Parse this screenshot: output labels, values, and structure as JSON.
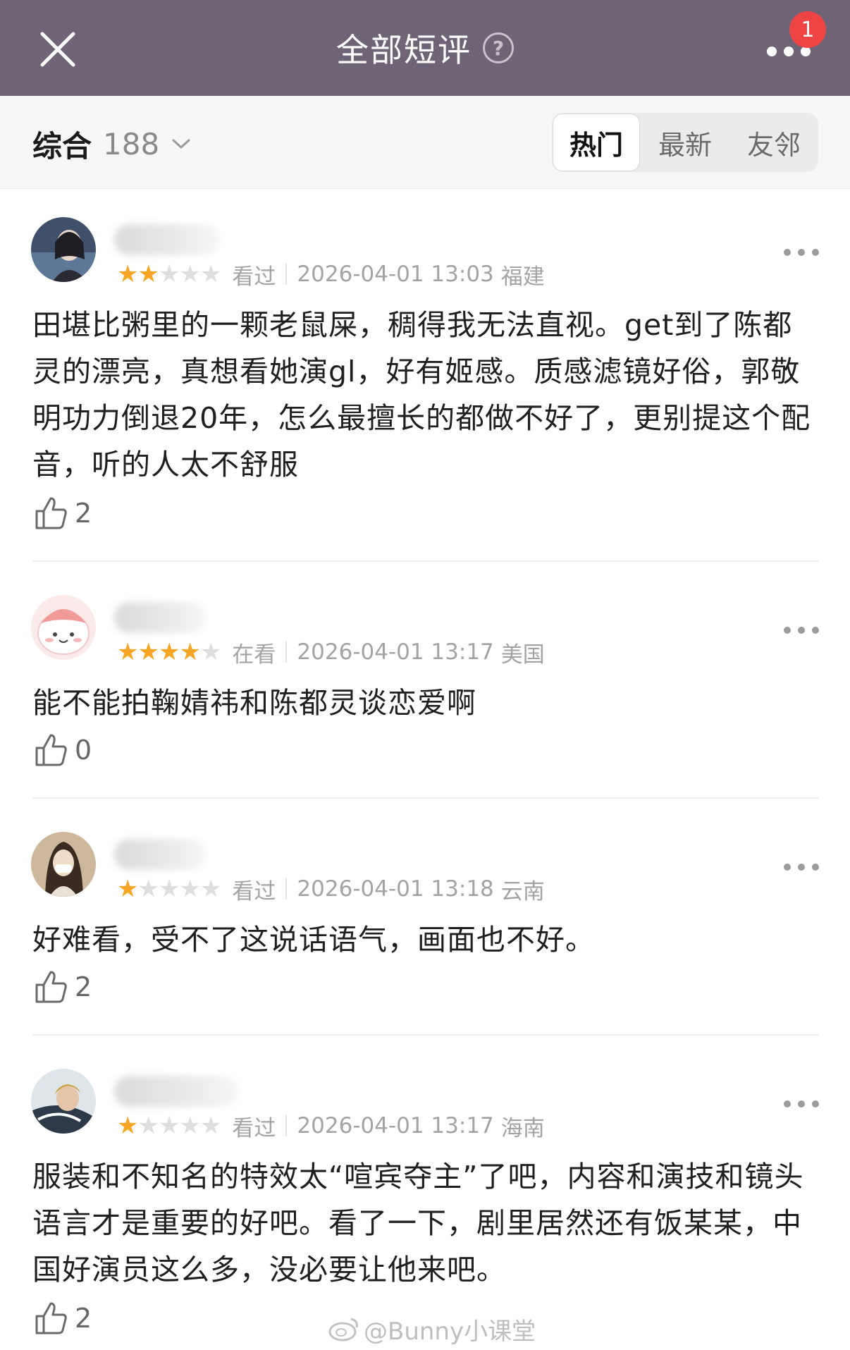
{
  "header": {
    "title": "全部短评",
    "help_glyph": "?",
    "notification_count": "1",
    "bg_color": "#6f6475"
  },
  "filter": {
    "sort_label": "综合",
    "sort_count": "188",
    "tabs": [
      {
        "label": "热门",
        "active": true
      },
      {
        "label": "最新",
        "active": false
      },
      {
        "label": "友邻",
        "active": false
      }
    ]
  },
  "comments": [
    {
      "username": "",
      "rating": 2,
      "status": "看过",
      "datetime": "2026-04-01 13:03",
      "location": "福建",
      "text": "田堪比粥里的一颗老鼠屎，稠得我无法直视。get到了陈都灵的漂亮，真想看她演gl，好有姬感。质感滤镜好俗，郭敬明功力倒退20年，怎么最擅长的都做不好了，更别提这个配音，听的人太不舒服",
      "likes": "2"
    },
    {
      "username": "",
      "rating": 4,
      "status": "在看",
      "datetime": "2026-04-01 13:17",
      "location": "美国",
      "text": "能不能拍鞠婧祎和陈都灵谈恋爱啊",
      "likes": "0"
    },
    {
      "username": "",
      "rating": 1,
      "status": "看过",
      "datetime": "2026-04-01 13:18",
      "location": "云南",
      "text": "好难看，受不了这说话语气，画面也不好。",
      "likes": "2"
    },
    {
      "username": "",
      "rating": 1,
      "status": "看过",
      "datetime": "2026-04-01 13:17",
      "location": "海南",
      "text": "服装和不知名的特效太“喧宾夺主”了吧，内容和演技和镜头语言才是重要的好吧。看了一下，剧里居然还有饭某某，中国好演员这么多，没必要让他来吧。",
      "likes": "2"
    }
  ],
  "watermark": "@Bunny小课堂",
  "icons": {
    "close": "close-icon",
    "help": "help-circle-icon",
    "more": "more-dots-icon",
    "like": "thumbs-up-icon",
    "star": "star-icon",
    "chevron": "chevron-down-icon"
  },
  "colors": {
    "star_on": "#f6a623",
    "star_off": "#dedede",
    "badge": "#ee4444"
  }
}
